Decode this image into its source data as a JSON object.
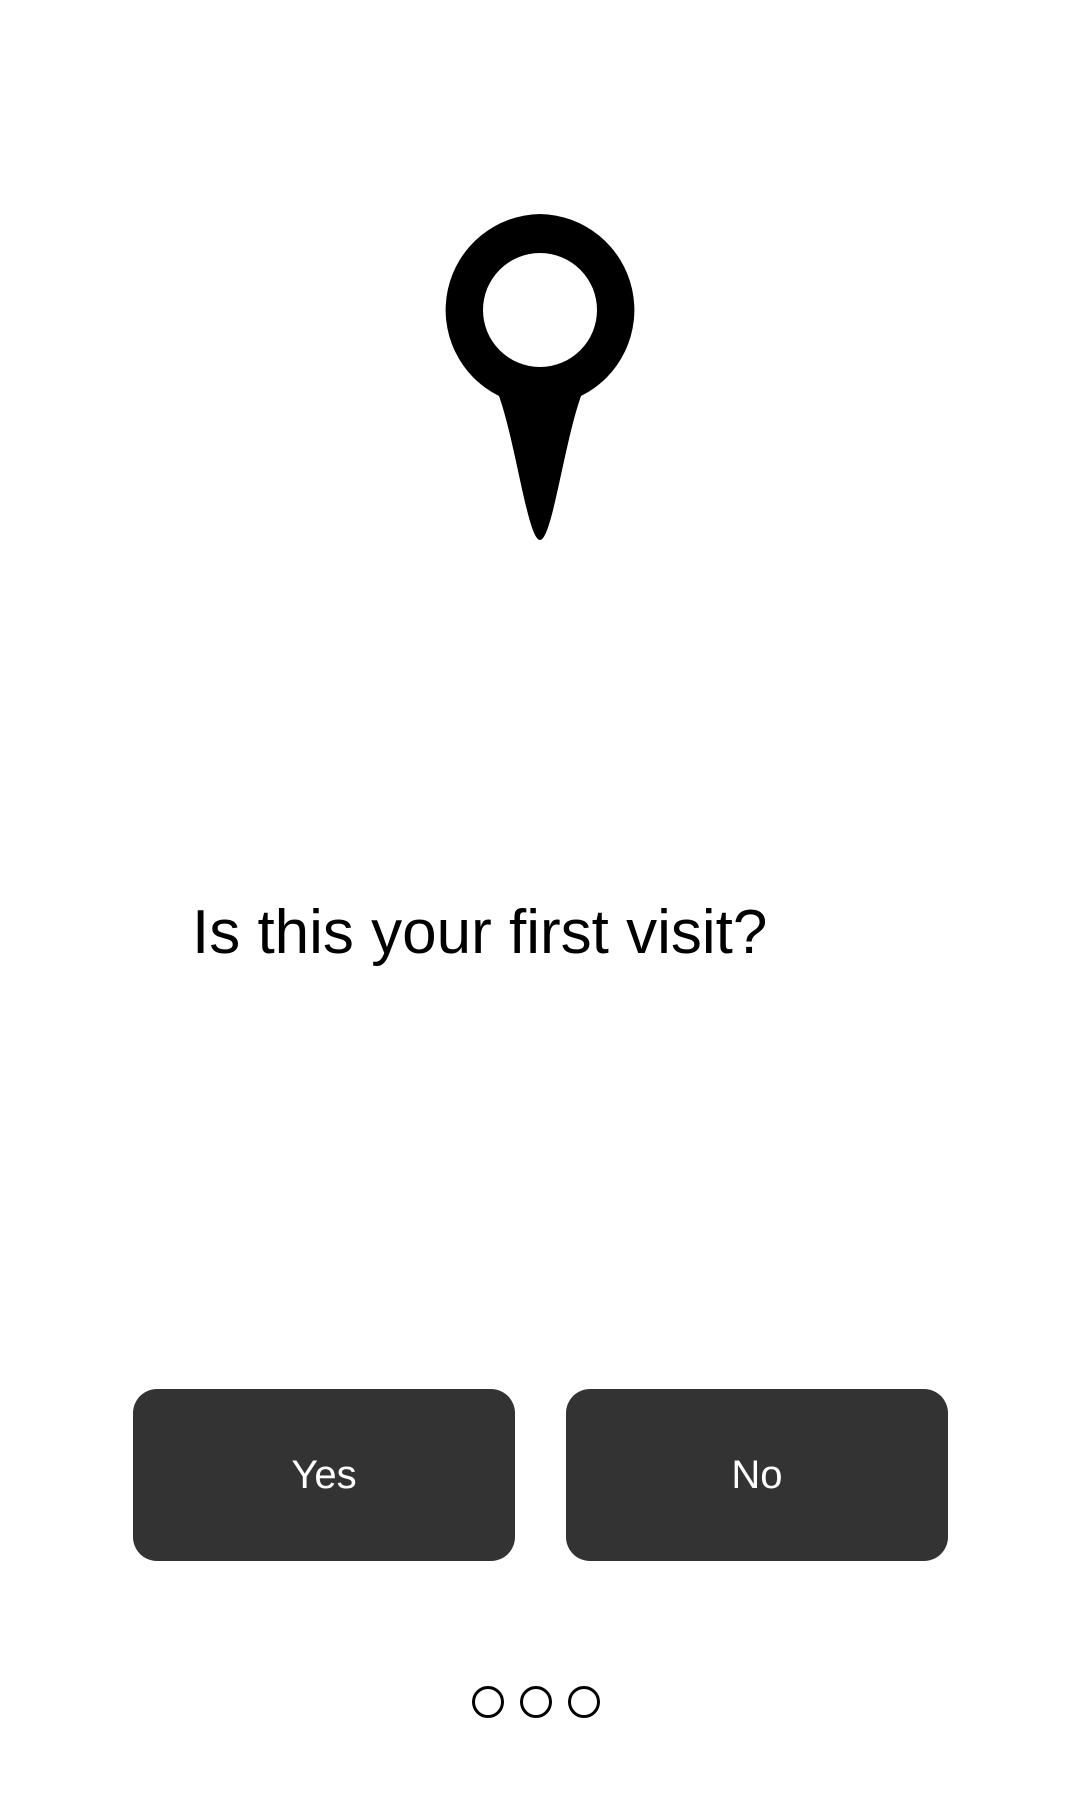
{
  "hero": {
    "icon": "map-pin-icon",
    "color": "#000000"
  },
  "question": {
    "text": "Is this your first visit?"
  },
  "buttons": {
    "yes_label": "Yes",
    "no_label": "No",
    "background": "#333333",
    "text_color": "#ffffff"
  },
  "pager": {
    "total_pages": 3
  }
}
